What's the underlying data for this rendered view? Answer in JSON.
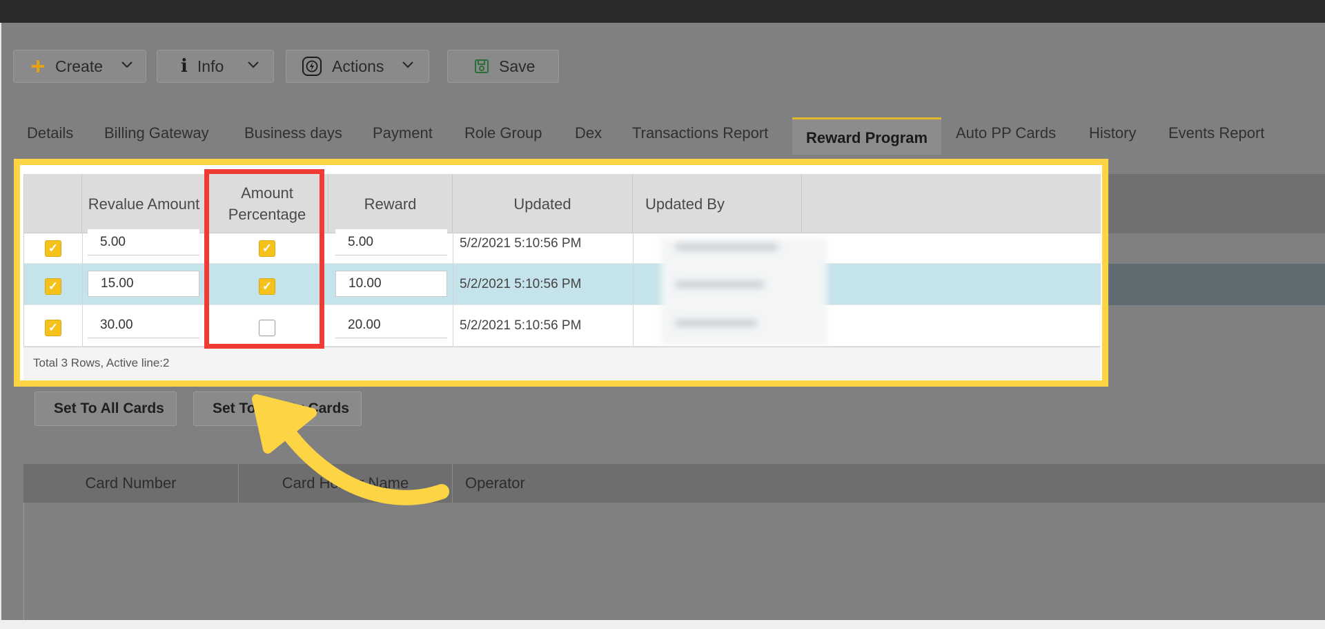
{
  "toolbar": {
    "create_label": "Create",
    "info_label": "Info",
    "actions_label": "Actions",
    "save_label": "Save"
  },
  "tabs": [
    {
      "label": "Details"
    },
    {
      "label": "Billing Gateway"
    },
    {
      "label": "Business days"
    },
    {
      "label": "Payment"
    },
    {
      "label": "Role Group"
    },
    {
      "label": "Dex"
    },
    {
      "label": "Transactions Report"
    },
    {
      "label": "Reward Program",
      "active": true
    },
    {
      "label": "Auto PP Cards"
    },
    {
      "label": "History"
    },
    {
      "label": "Events Report"
    }
  ],
  "grid": {
    "headers": {
      "revalue_amount": "Revalue Amount",
      "amount_percentage": "Amount Percentage",
      "reward": "Reward",
      "updated": "Updated",
      "updated_by": "Updated By"
    },
    "rows": [
      {
        "selected": true,
        "revalue_amount": "5.00",
        "amount_percentage": true,
        "reward": "5.00",
        "updated": "5/2/2021 5:10:56 PM"
      },
      {
        "selected": true,
        "revalue_amount": "15.00",
        "amount_percentage": true,
        "reward": "10.00",
        "updated": "5/2/2021 5:10:56 PM"
      },
      {
        "selected": true,
        "revalue_amount": "30.00",
        "amount_percentage": false,
        "reward": "20.00",
        "updated": "5/2/2021 5:10:56 PM"
      }
    ],
    "footer": "Total 3 Rows, Active line:2"
  },
  "actions": {
    "set_all_label": "Set To All Cards",
    "set_empty_label": "Set To Empty Cards"
  },
  "cards_table": {
    "headers": [
      "Card Number",
      "Card Holder Name",
      "Operator"
    ]
  },
  "colors": {
    "highlight_frame": "#fdd444",
    "red_box": "#f03b35",
    "checkbox_on": "#f4c21b",
    "active_tab_border": "#e2b82b",
    "selected_row": "#c5e3ea"
  }
}
